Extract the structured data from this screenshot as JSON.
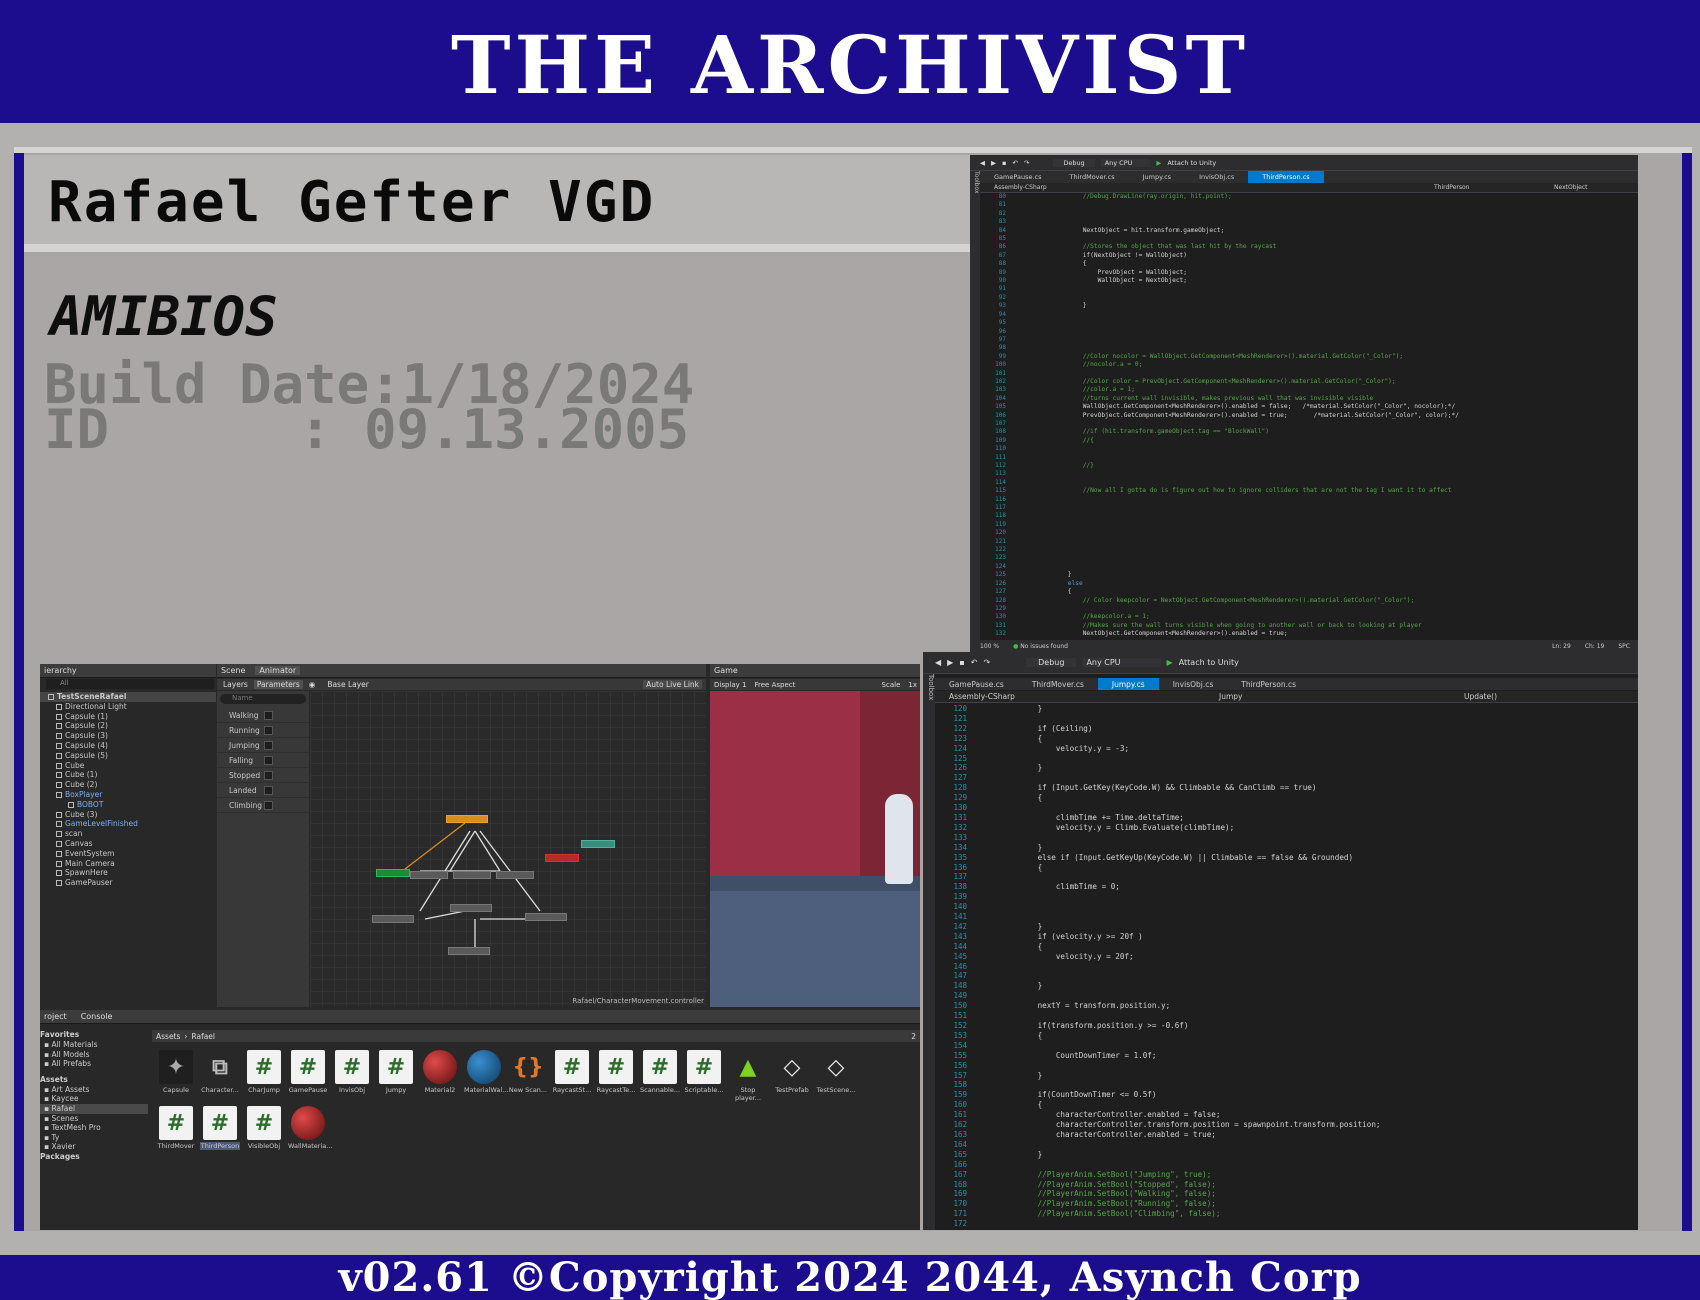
{
  "banner": {
    "title": "THE ARCHIVIST"
  },
  "profile": {
    "author": "Rafael Gefter VGD",
    "bios": "AMIBIOS",
    "build_label": "Build Date:",
    "build_value": "1/18/2024",
    "id_label": "ID",
    "id_sep": ":",
    "id_value": "09.13.2005"
  },
  "footer": {
    "text": "v02.61 ©Copyright 2024 2044, Asynch Corp"
  },
  "vs_top": {
    "toolbar": {
      "config": "Debug",
      "platform": "Any CPU",
      "attach": "Attach to Unity"
    },
    "side_label": "Toolbox",
    "tabs": [
      "GamePause.cs",
      "ThirdMover.cs",
      "Jumpy.cs",
      "InvisObj.cs",
      "ThirdPerson.cs"
    ],
    "active_tab": 4,
    "nav": {
      "project": "Assembly-CSharp",
      "class": "ThirdPerson",
      "member": "NextObject"
    },
    "status": {
      "zoom": "100 %",
      "issues": "No issues found",
      "ln": "Ln: 29",
      "ch": "Ch: 19",
      "enc": "SPC"
    },
    "lines": [
      {
        "n": "80",
        "t": "            //Debug.DrawLine(ray.origin, hit.point);",
        "c": "cmt"
      },
      {
        "n": "81",
        "t": ""
      },
      {
        "n": "82",
        "t": ""
      },
      {
        "n": "83",
        "t": ""
      },
      {
        "n": "84",
        "t": "            NextObject = hit.transform.gameObject;"
      },
      {
        "n": "85",
        "t": ""
      },
      {
        "n": "86",
        "t": "            //Stores the object that was last hit by the raycast",
        "c": "cmt"
      },
      {
        "n": "87",
        "t": "            if(NextObject != WallObject)"
      },
      {
        "n": "88",
        "t": "            {"
      },
      {
        "n": "89",
        "t": "                PrevObject = WallObject;"
      },
      {
        "n": "90",
        "t": "                WallObject = NextObject;"
      },
      {
        "n": "91",
        "t": ""
      },
      {
        "n": "92",
        "t": ""
      },
      {
        "n": "93",
        "t": "            }"
      },
      {
        "n": "94",
        "t": ""
      },
      {
        "n": "95",
        "t": ""
      },
      {
        "n": "96",
        "t": ""
      },
      {
        "n": "97",
        "t": ""
      },
      {
        "n": "98",
        "t": ""
      },
      {
        "n": "99",
        "t": "            //Color nocolor = WallObject.GetComponent<MeshRenderer>().material.GetColor(\"_Color\");",
        "c": "cmt"
      },
      {
        "n": "100",
        "t": "            //nocolor.a = 0;",
        "c": "cmt"
      },
      {
        "n": "101",
        "t": ""
      },
      {
        "n": "102",
        "t": "            //Color color = PrevObject.GetComponent<MeshRenderer>().material.GetColor(\"_Color\");",
        "c": "cmt"
      },
      {
        "n": "103",
        "t": "            //color.a = 1;",
        "c": "cmt"
      },
      {
        "n": "104",
        "t": "            //turns current wall invisible, makes previous wall that was invisible visible",
        "c": "cmt"
      },
      {
        "n": "105",
        "t": "            WallObject.GetComponent<MeshRenderer>().enabled = false;   /*material.SetColor(\"_Color\", nocolor);*/"
      },
      {
        "n": "106",
        "t": "            PrevObject.GetComponent<MeshRenderer>().enabled = true;       /*material.SetColor(\"_Color\", color);*/"
      },
      {
        "n": "107",
        "t": ""
      },
      {
        "n": "108",
        "t": "            //if (hit.transform.gameObject.tag == \"BlockWall\")",
        "c": "cmt"
      },
      {
        "n": "109",
        "t": "            //{",
        "c": "cmt"
      },
      {
        "n": "110",
        "t": ""
      },
      {
        "n": "111",
        "t": ""
      },
      {
        "n": "112",
        "t": "            //}",
        "c": "cmt"
      },
      {
        "n": "113",
        "t": ""
      },
      {
        "n": "114",
        "t": ""
      },
      {
        "n": "115",
        "t": "            //Now all I gotta do is figure out how to ignore colliders that are not the tag I want it to affect",
        "c": "cmt"
      },
      {
        "n": "116",
        "t": ""
      },
      {
        "n": "117",
        "t": ""
      },
      {
        "n": "118",
        "t": ""
      },
      {
        "n": "119",
        "t": ""
      },
      {
        "n": "120",
        "t": ""
      },
      {
        "n": "121",
        "t": ""
      },
      {
        "n": "122",
        "t": ""
      },
      {
        "n": "123",
        "t": ""
      },
      {
        "n": "124",
        "t": ""
      },
      {
        "n": "125",
        "t": "        }"
      },
      {
        "n": "126",
        "t": "        else",
        "c": "kw"
      },
      {
        "n": "127",
        "t": "        {"
      },
      {
        "n": "128",
        "t": "            // Color keepcolor = NextObject.GetComponent<MeshRenderer>().material.GetColor(\"_Color\");",
        "c": "cmt"
      },
      {
        "n": "129",
        "t": ""
      },
      {
        "n": "130",
        "t": "            //keepcolor.a = 1;",
        "c": "cmt"
      },
      {
        "n": "131",
        "t": "            //Makes sure the wall turns visible when going to another wall or back to looking at player",
        "c": "cmt"
      },
      {
        "n": "132",
        "t": "            NextObject.GetComponent<MeshRenderer>().enabled = true;"
      }
    ]
  },
  "vs_bottom": {
    "toolbar": {
      "config": "Debug",
      "platform": "Any CPU",
      "attach": "Attach to Unity"
    },
    "side_label": "Toolbox",
    "tabs": [
      "GamePause.cs",
      "ThirdMover.cs",
      "Jumpy.cs",
      "InvisObj.cs",
      "ThirdPerson.cs"
    ],
    "active_tab": 2,
    "nav": {
      "project": "Assembly-CSharp",
      "class": "Jumpy",
      "member": "Update()"
    },
    "lines": [
      {
        "n": "120",
        "t": "        }"
      },
      {
        "n": "121",
        "t": ""
      },
      {
        "n": "122",
        "t": "        if (Ceiling)"
      },
      {
        "n": "123",
        "t": "        {"
      },
      {
        "n": "124",
        "t": "            velocity.y = -3;"
      },
      {
        "n": "125",
        "t": ""
      },
      {
        "n": "126",
        "t": "        }"
      },
      {
        "n": "127",
        "t": ""
      },
      {
        "n": "128",
        "t": "        if (Input.GetKey(KeyCode.W) && Climbable && CanClimb == true)"
      },
      {
        "n": "129",
        "t": "        {"
      },
      {
        "n": "130",
        "t": ""
      },
      {
        "n": "131",
        "t": "            climbTime += Time.deltaTime;"
      },
      {
        "n": "132",
        "t": "            velocity.y = Climb.Evaluate(climbTime);"
      },
      {
        "n": "133",
        "t": ""
      },
      {
        "n": "134",
        "t": "        }"
      },
      {
        "n": "135",
        "t": "        else if (Input.GetKeyUp(KeyCode.W) || Climbable == false && Grounded)"
      },
      {
        "n": "136",
        "t": "        {"
      },
      {
        "n": "137",
        "t": ""
      },
      {
        "n": "138",
        "t": "            climbTime = 0;"
      },
      {
        "n": "139",
        "t": ""
      },
      {
        "n": "140",
        "t": ""
      },
      {
        "n": "141",
        "t": ""
      },
      {
        "n": "142",
        "t": "        }"
      },
      {
        "n": "143",
        "t": "        if (velocity.y >= 20f )"
      },
      {
        "n": "144",
        "t": "        {"
      },
      {
        "n": "145",
        "t": "            velocity.y = 20f;"
      },
      {
        "n": "146",
        "t": ""
      },
      {
        "n": "147",
        "t": ""
      },
      {
        "n": "148",
        "t": "        }"
      },
      {
        "n": "149",
        "t": ""
      },
      {
        "n": "150",
        "t": "        nextY = transform.position.y;"
      },
      {
        "n": "151",
        "t": ""
      },
      {
        "n": "152",
        "t": "        if(transform.position.y >= -0.6f)"
      },
      {
        "n": "153",
        "t": "        {"
      },
      {
        "n": "154",
        "t": ""
      },
      {
        "n": "155",
        "t": "            CountDownTimer = 1.0f;"
      },
      {
        "n": "156",
        "t": ""
      },
      {
        "n": "157",
        "t": "        }"
      },
      {
        "n": "158",
        "t": ""
      },
      {
        "n": "159",
        "t": "        if(CountDownTimer <= 0.5f)"
      },
      {
        "n": "160",
        "t": "        {"
      },
      {
        "n": "161",
        "t": "            characterController.enabled = false;"
      },
      {
        "n": "162",
        "t": "            characterController.transform.position = spawnpoint.transform.position;"
      },
      {
        "n": "163",
        "t": "            characterController.enabled = true;"
      },
      {
        "n": "164",
        "t": ""
      },
      {
        "n": "165",
        "t": "        }"
      },
      {
        "n": "166",
        "t": ""
      },
      {
        "n": "167",
        "t": "        //PlayerAnim.SetBool(\"Jumping\", true);",
        "c": "cmt"
      },
      {
        "n": "168",
        "t": "        //PlayerAnim.SetBool(\"Stopped\", false);",
        "c": "cmt"
      },
      {
        "n": "169",
        "t": "        //PlayerAnim.SetBool(\"Walking\", false);",
        "c": "cmt"
      },
      {
        "n": "170",
        "t": "        //PlayerAnim.SetBool(\"Running\", false);",
        "c": "cmt"
      },
      {
        "n": "171",
        "t": "        //PlayerAnim.SetBool(\"Climbing\", false);",
        "c": "cmt"
      },
      {
        "n": "172",
        "t": ""
      }
    ]
  },
  "unity": {
    "hierarchy": {
      "title": "ierarchy",
      "search": "All",
      "items": [
        "TestSceneRafael",
        "Directional Light",
        "Capsule (1)",
        "Capsule (2)",
        "Capsule (3)",
        "Capsule (4)",
        "Capsule (5)",
        "Cube",
        "Cube (1)",
        "Cube (2)",
        "BoxPlayer",
        "BOBOT",
        "Cube (3)",
        "GameLevelFinished",
        "scan",
        "Canvas",
        "EventSystem",
        "Main Camera",
        "SpawnHere",
        "GamePauser"
      ]
    },
    "scene_tabs": [
      "Scene",
      "Animator"
    ],
    "game_tab": "Game",
    "animator": {
      "layers": "Layers",
      "parameters": "Parameters",
      "base_layer": "Base Layer",
      "auto_live": "Auto Live Link",
      "name_placeholder": "Name",
      "params": [
        "Walking",
        "Running",
        "Jumping",
        "Falling",
        "Stopped",
        "Landed",
        "Climbing"
      ],
      "path": "Rafael/CharacterMovement.controller"
    },
    "game": {
      "display": "Display 1",
      "aspect": "Free Aspect",
      "scale": "Scale",
      "scale_value": "1x"
    },
    "project": {
      "tabs": [
        "roject",
        "Console"
      ],
      "favorites_title": "Favorites",
      "favorites": [
        "All Materials",
        "All Models",
        "All Prefabs"
      ],
      "assets_title": "Assets",
      "folders": [
        "Art Assets",
        "Kaycee",
        "Rafael",
        "Scenes",
        "TextMesh Pro",
        "Ty",
        "Xavier"
      ],
      "packages": "Packages",
      "breadcrumb_root": "Assets",
      "breadcrumb_leaf": "Rafael",
      "count": "2",
      "assets": [
        "Capsule",
        "Character...",
        "CharJump",
        "GamePause",
        "InvisObj",
        "Jumpy",
        "Material2",
        "MaterialWal...",
        "New Scan...",
        "RaycastSt...",
        "RaycastTe...",
        "Scannable...",
        "Scriptable...",
        "Stop player...",
        "TestPrefab",
        "TestScene...",
        "ThirdMover",
        "ThirdPerson",
        "VisibleObj",
        "WallMateria..."
      ]
    }
  },
  "colors": {
    "banner": "#1c0d8e",
    "frame": "#aaa6a6",
    "vs_bg": "#1e1e1e",
    "vs_accent": "#007acc",
    "comment": "#57a64a",
    "keyword": "#569cd6"
  }
}
